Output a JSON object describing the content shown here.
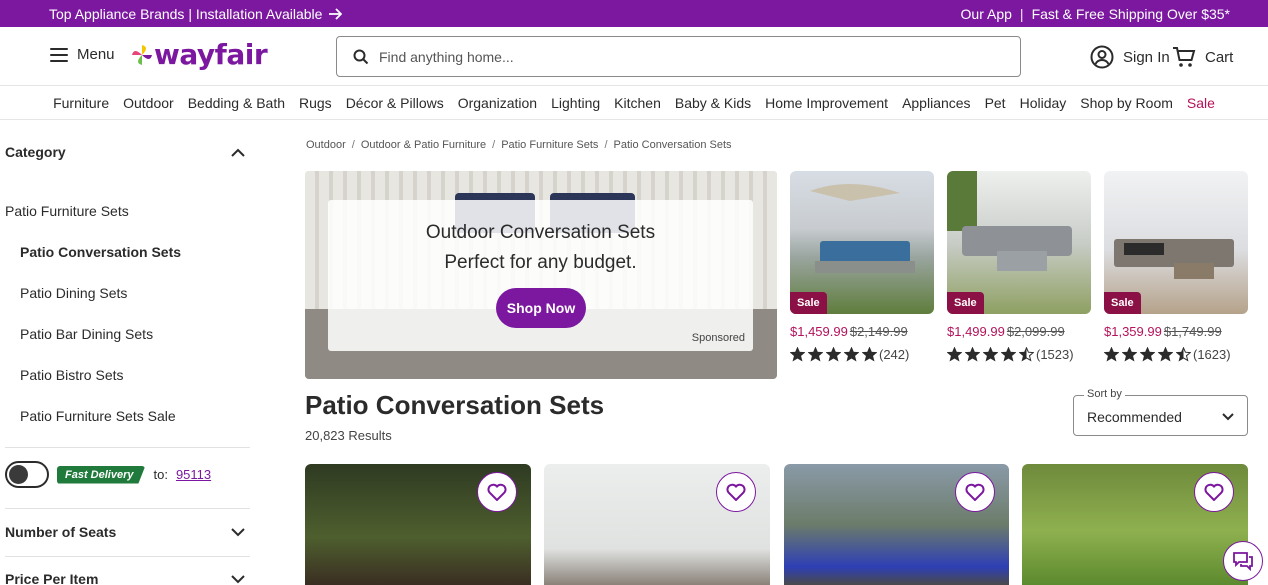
{
  "promo": {
    "left_text": "Top Appliance Brands | Installation Available",
    "right_app": "Our App",
    "right_sep": "|",
    "right_shipping": "Fast & Free Shipping Over $35*"
  },
  "header": {
    "menu_label": "Menu",
    "logo_text": "wayfair",
    "search_placeholder": "Find anything home...",
    "sign_in": "Sign In",
    "cart": "Cart"
  },
  "nav": {
    "items": [
      "Furniture",
      "Outdoor",
      "Bedding & Bath",
      "Rugs",
      "Décor & Pillows",
      "Organization",
      "Lighting",
      "Kitchen",
      "Baby & Kids",
      "Home Improvement",
      "Appliances",
      "Pet",
      "Holiday",
      "Shop by Room",
      "Sale"
    ]
  },
  "sidebar": {
    "category_heading": "Category",
    "items": [
      {
        "label": "Patio Furniture Sets"
      },
      {
        "label": "Patio Conversation Sets"
      },
      {
        "label": "Patio Dining Sets"
      },
      {
        "label": "Patio Bar Dining Sets"
      },
      {
        "label": "Patio Bistro Sets"
      },
      {
        "label": "Patio Furniture Sets Sale"
      }
    ],
    "fast_delivery_badge": "Fast Delivery",
    "to_label": "to:",
    "zip": "95113",
    "filter_seats": "Number of Seats",
    "filter_price": "Price Per Item"
  },
  "breadcrumb": {
    "items": [
      "Outdoor",
      "Outdoor & Patio Furniture",
      "Patio Furniture Sets",
      "Patio Conversation Sets"
    ],
    "sep": "/"
  },
  "banner": {
    "title": "Outdoor Conversation Sets",
    "subtitle": "Perfect for any budget.",
    "button": "Shop Now",
    "sponsored": "Sponsored"
  },
  "featured": [
    {
      "sale_tag": "Sale",
      "price": "$1,459.99",
      "was": "$2,149.99",
      "stars": 5,
      "reviews": "(242)"
    },
    {
      "sale_tag": "Sale",
      "price": "$1,499.99",
      "was": "$2,099.99",
      "stars": 4.5,
      "reviews": "(1523)"
    },
    {
      "sale_tag": "Sale",
      "price": "$1,359.99",
      "was": "$1,749.99",
      "stars": 4.5,
      "reviews": "(1623)"
    }
  ],
  "listing": {
    "title": "Patio Conversation Sets",
    "results": "20,823 Results",
    "sort_label": "Sort by",
    "sort_value": "Recommended"
  },
  "colors": {
    "brand": "#7b189f",
    "sale": "#b5125b",
    "fast_delivery": "#1f7a3b"
  }
}
